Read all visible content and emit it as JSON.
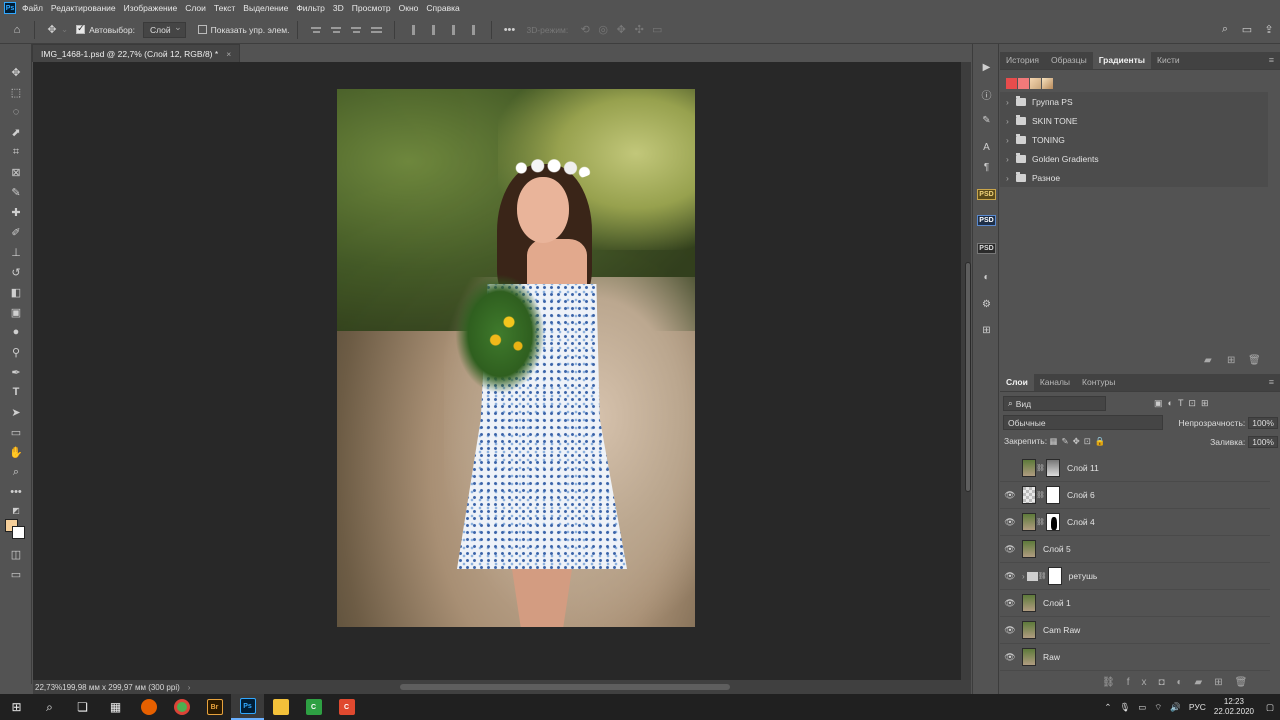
{
  "menubar": {
    "logo": "Ps",
    "items": [
      "Файл",
      "Редактирование",
      "Изображение",
      "Слои",
      "Текст",
      "Выделение",
      "Фильтр",
      "3D",
      "Просмотр",
      "Окно",
      "Справка"
    ]
  },
  "options": {
    "autoselect_label": "Автовыбор:",
    "autoselect_value": "Слой",
    "show_controls_label": "Показать упр. элем.",
    "mode_3d": "3D-режим:"
  },
  "document": {
    "tab_title": "IMG_1468-1.psd @ 22,7% (Слой 12, RGB/8) *",
    "close": "×"
  },
  "status": {
    "zoom_info": "22,73%",
    "dimensions": "199,98 мм x 299,97 мм (300 ppi)"
  },
  "gradients_panel": {
    "tabs": [
      "История",
      "Образцы",
      "Градиенты",
      "Кисти"
    ],
    "active_tab": "Градиенты",
    "preset_colors": [
      "#e84c4c",
      "#f07a7a",
      "#f5d6b0",
      "#e8c48a"
    ],
    "folders": [
      "Группа PS",
      "SKIN TONE",
      "TONING",
      "Golden Gradients",
      "Разное"
    ]
  },
  "layers_panel": {
    "tabs": [
      "Слои",
      "Каналы",
      "Контуры"
    ],
    "active_tab": "Слои",
    "search_placeholder": "Вид",
    "blend_mode": "Обычные",
    "opacity_label": "Непрозрачность:",
    "opacity_value": "100%",
    "lock_label": "Закрепить:",
    "fill_label": "Заливка:",
    "fill_value": "100%",
    "layers": [
      {
        "name": "Слой 11",
        "visible": false
      },
      {
        "name": "Слой 6",
        "visible": true
      },
      {
        "name": "Слой 4",
        "visible": true
      },
      {
        "name": "Слой 5",
        "visible": true
      },
      {
        "name": "ретушь",
        "visible": true
      },
      {
        "name": "Слой 1",
        "visible": true
      },
      {
        "name": "Cam Raw",
        "visible": true
      },
      {
        "name": "Raw",
        "visible": true
      }
    ]
  },
  "taskbar": {
    "language": "РУС",
    "time": "12:23",
    "date": "22.02.2020"
  },
  "colors": {
    "foreground": "#f5cf9a",
    "background": "#ffffff",
    "ps_blue": "#31a8ff"
  }
}
